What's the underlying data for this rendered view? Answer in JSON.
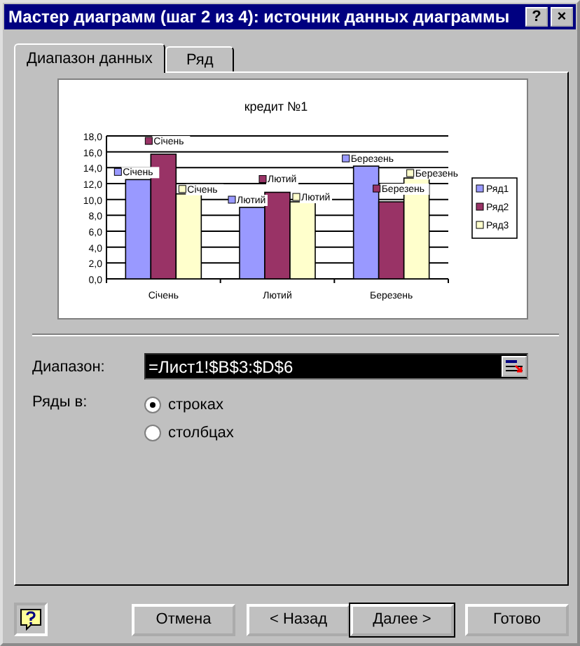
{
  "window": {
    "title": "Мастер диаграмм (шаг 2 из 4): источник данных диаграммы",
    "help_button": "?",
    "close_button": "×"
  },
  "tabs": [
    {
      "label": "Диапазон данных",
      "selected": true
    },
    {
      "label": "Ряд",
      "selected": false
    }
  ],
  "preview": {
    "chart_data": {
      "type": "bar",
      "title": "кредит №1",
      "categories": [
        "Січень",
        "Лютий",
        "Березень"
      ],
      "series": [
        {
          "name": "Ряд1",
          "color": "#9999ff",
          "values": [
            12.5,
            9.0,
            14.2
          ]
        },
        {
          "name": "Ряд2",
          "color": "#993366",
          "values": [
            15.7,
            10.9,
            9.7
          ]
        },
        {
          "name": "Ряд3",
          "color": "#ffffcc",
          "values": [
            10.7,
            9.7,
            12.7
          ]
        }
      ],
      "ylim": [
        0,
        18
      ],
      "grid": true,
      "legend": true,
      "yticks": [
        {
          "value": 0,
          "label": "0,0"
        },
        {
          "value": 2,
          "label": "2,0"
        },
        {
          "value": 4,
          "label": "4,0"
        },
        {
          "value": 6,
          "label": "6,0"
        },
        {
          "value": 8,
          "label": "8,0"
        },
        {
          "value": 10,
          "label": "10,0"
        },
        {
          "value": 12,
          "label": "12,0"
        },
        {
          "value": 14,
          "label": "14,0"
        },
        {
          "value": 16,
          "label": "16,0"
        },
        {
          "value": 18,
          "label": "18,0"
        }
      ],
      "value_labels": [
        [
          "Січень",
          "Лютий",
          "Березень"
        ],
        [
          "Січень",
          "Лютий",
          "Березень"
        ],
        [
          "Січень",
          "Лютий",
          "Березень"
        ]
      ]
    }
  },
  "range": {
    "label": "Диапазон:",
    "value": "=Лист1!$B$3:$D$6"
  },
  "series_in": {
    "label": "Ряды в:",
    "options": [
      {
        "label": "строках",
        "selected": true
      },
      {
        "label": "столбцах",
        "selected": false
      }
    ]
  },
  "buttons": [
    {
      "label": "Отмена",
      "default": false
    },
    {
      "label": "< Назад",
      "default": false
    },
    {
      "label": "Далее >",
      "default": true
    },
    {
      "label": "Готово",
      "default": false
    }
  ]
}
